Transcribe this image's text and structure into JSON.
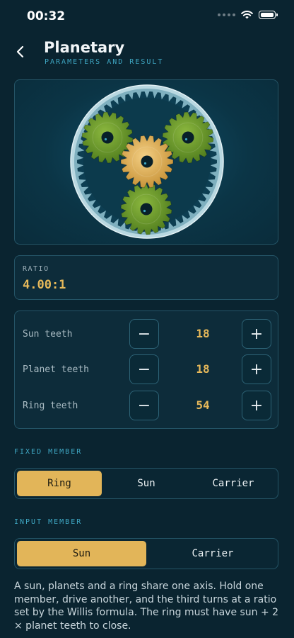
{
  "status": {
    "time": "00:32"
  },
  "header": {
    "title": "Planetary",
    "subtitle": "PARAMETERS AND RESULT"
  },
  "ratio": {
    "label": "RATIO",
    "value": "4.00:1"
  },
  "teeth": [
    {
      "label": "Sun teeth",
      "value": "18"
    },
    {
      "label": "Planet teeth",
      "value": "18"
    },
    {
      "label": "Ring teeth",
      "value": "54"
    }
  ],
  "stepper": {
    "minus": "−",
    "plus": "+"
  },
  "fixed": {
    "label": "FIXED MEMBER",
    "options": [
      "Ring",
      "Sun",
      "Carrier"
    ],
    "selected": "Ring"
  },
  "input": {
    "label": "INPUT MEMBER",
    "options": [
      "Sun",
      "Carrier"
    ],
    "selected": "Sun"
  },
  "description": "A sun, planets and a ring share one axis. Hold one member, drive another, and the third turns at a ratio set by the Willis formula. The ring must have sun + 2 × planet teeth to close.",
  "colors": {
    "accent": "#e2b559",
    "cyan": "#3fa7c3",
    "planet": "#6f9e2c",
    "sun": "#e3b35a",
    "ring": "#a9ccd6"
  }
}
